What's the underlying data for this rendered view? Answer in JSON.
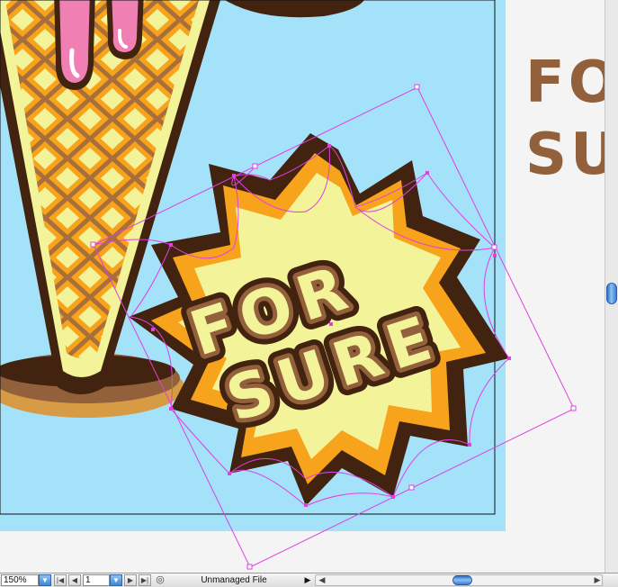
{
  "artwork": {
    "badge_line1": "FOR",
    "badge_line2": "SURE",
    "pasteboard_text": "FO\nSU"
  },
  "colors": {
    "sky": "#a4e2fa",
    "cone_fill": "#f3f39a",
    "cone_stroke": "#4a2a12",
    "waffle_orange": "#f7a31c",
    "chocolate": "#42230f",
    "milk_chocolate": "#92603a",
    "pink": "#f07fb4",
    "selection": "#e040e0"
  },
  "status_bar": {
    "zoom": "150%",
    "zoom_dropdown_icon": "triangle-down",
    "page": "1",
    "page_dropdown_icon": "triangle-down",
    "status_text": "Unmanaged File",
    "status_menu_icon": "triangle-right",
    "first_page_icon": "skip-first",
    "prev_page_icon": "triangle-left",
    "next_page_icon": "triangle-right",
    "last_page_icon": "skip-last"
  }
}
